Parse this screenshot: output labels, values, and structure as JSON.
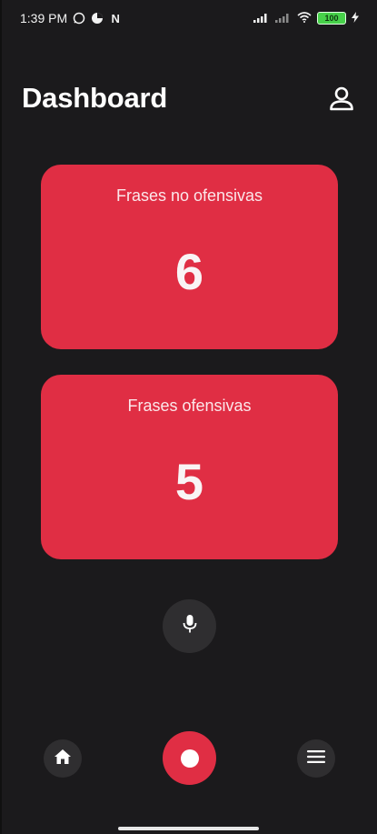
{
  "status_bar": {
    "time": "1:39 PM",
    "notification_icons": [
      "whatsapp-icon",
      "pie-app-icon",
      "netflix-icon"
    ],
    "netflix_glyph": "N",
    "system_icons": [
      "signal-icon",
      "signal-icon",
      "wifi-icon"
    ],
    "battery_level": "100"
  },
  "header": {
    "title": "Dashboard",
    "profile_icon": "user-icon"
  },
  "cards": [
    {
      "label": "Frases no ofensivas",
      "count": "6"
    },
    {
      "label": "Frases ofensivas",
      "count": "5"
    }
  ],
  "mic_button": {
    "icon": "microphone-icon"
  },
  "bottom_nav": {
    "home_icon": "home-icon",
    "record_icon": "record-icon",
    "menu_icon": "menu-icon"
  },
  "colors": {
    "background": "#1b1a1c",
    "accent": "#e02e44",
    "surface": "#2f2e30",
    "text": "#ffffff"
  }
}
